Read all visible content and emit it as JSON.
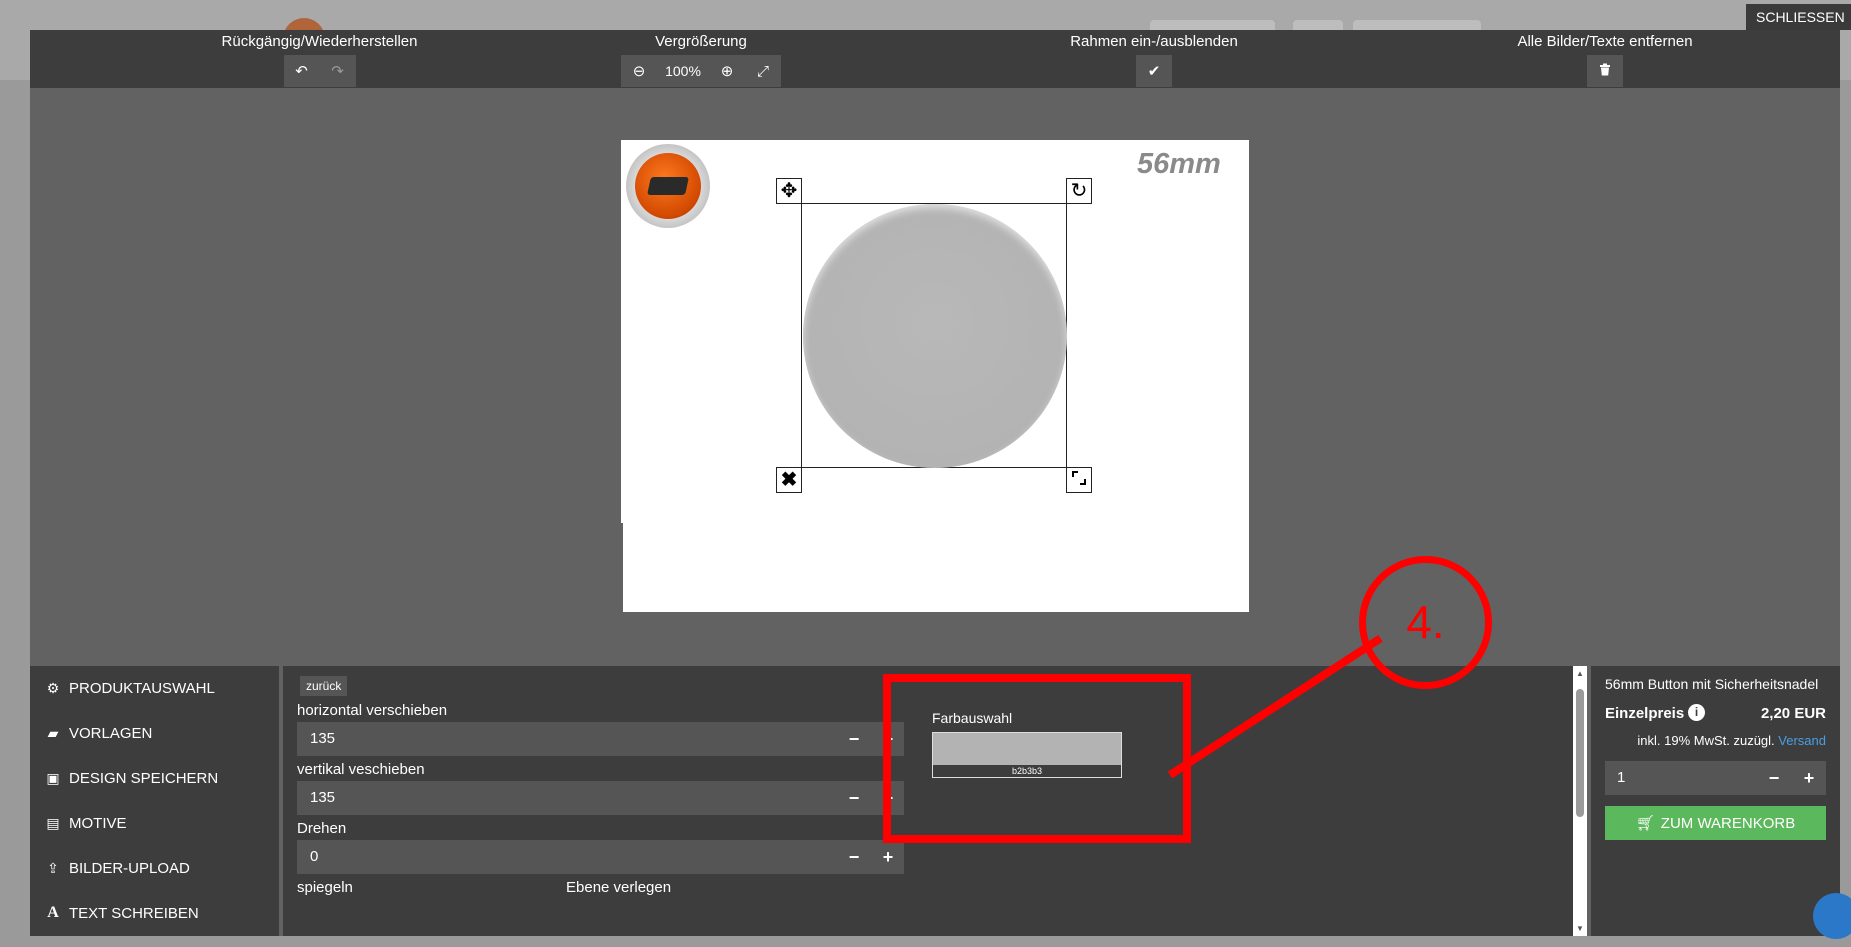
{
  "window": {
    "close_label": "SCHLIESSEN"
  },
  "toolbar": {
    "undo_redo_label": "Rückgängig/Wiederherstellen",
    "zoom_label": "Vergrößerung",
    "zoom_value": "100%",
    "frame_label": "Rahmen ein-/ausblenden",
    "remove_all_label": "Alle Bilder/Texte entfernen"
  },
  "canvas": {
    "size_label": "56mm"
  },
  "sidebar": {
    "items": [
      {
        "label": "PRODUKTAUSWAHL",
        "icon": "cubes-icon"
      },
      {
        "label": "VORLAGEN",
        "icon": "folder-open-icon"
      },
      {
        "label": "DESIGN SPEICHERN",
        "icon": "save-icon"
      },
      {
        "label": "MOTIVE",
        "icon": "image-icon"
      },
      {
        "label": "BILDER-UPLOAD",
        "icon": "upload-icon"
      },
      {
        "label": "TEXT SCHREIBEN",
        "icon": "text-icon"
      }
    ]
  },
  "props": {
    "back_label": "zurück",
    "horizontal": {
      "label": "horizontal verschieben",
      "value": "135"
    },
    "vertical": {
      "label": "vertikal veschieben",
      "value": "135"
    },
    "rotate": {
      "label": "Drehen",
      "value": "0"
    },
    "mirror_label": "spiegeln",
    "layer_label": "Ebene verlegen",
    "color_label": "Farbauswahl",
    "color_hex": "b2b3b3",
    "color_value": "#b3b3b3"
  },
  "cart": {
    "product_title": "56mm Button mit Sicherheitsnadel",
    "price_label": "Einzelpreis",
    "price_value": "2,20 EUR",
    "tax_note": "inkl. 19% MwSt. zuzügl.",
    "shipping_link": "Versand",
    "quantity": "1",
    "add_to_cart_label": "ZUM WARENKORB"
  },
  "annotation": {
    "step_number": "4."
  },
  "colors": {
    "accent_green": "#5cb85c",
    "annotation_red": "#ff0000",
    "link_blue": "#4a9ee6"
  }
}
